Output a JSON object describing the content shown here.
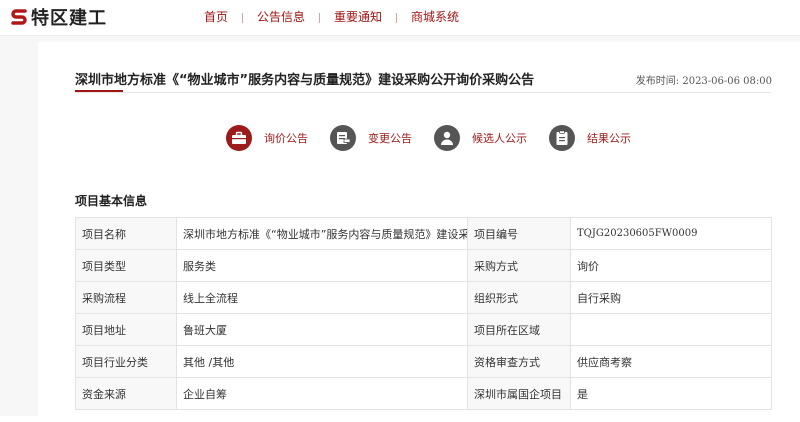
{
  "header": {
    "logo_text": "特区建工",
    "nav": [
      "首页",
      "公告信息",
      "重要通知",
      "商城系统"
    ]
  },
  "article": {
    "title": "深圳市地方标准《“物业城市”服务内容与质量规范》建设采购公开询价采购公告",
    "publish_date": "发布时间: 2023-06-06 08:00"
  },
  "tabs": [
    {
      "label": "询价公告",
      "icon": "briefcase-icon",
      "active": true
    },
    {
      "label": "变更公告",
      "icon": "document-edit-icon",
      "active": false
    },
    {
      "label": "候选人公示",
      "icon": "person-icon",
      "active": false
    },
    {
      "label": "结果公示",
      "icon": "clipboard-icon",
      "active": false
    }
  ],
  "section_title": "项目基本信息",
  "info_rows": [
    {
      "k1": "项目名称",
      "v1": "深圳市地方标准《“物业城市”服务内容与质量规范》建设采购",
      "k2": "项目编号",
      "v2": "TQJG20230605FW0009"
    },
    {
      "k1": "项目类型",
      "v1": "服务类",
      "k2": "采购方式",
      "v2": "询价"
    },
    {
      "k1": "采购流程",
      "v1": "线上全流程",
      "k2": "组织形式",
      "v2": "自行采购"
    },
    {
      "k1": "项目地址",
      "v1": "鲁班大厦",
      "k2": "项目所在区域",
      "v2": ""
    },
    {
      "k1": "项目行业分类",
      "v1": "其他 /其他",
      "k2": "资格审查方式",
      "v2": "供应商考察"
    },
    {
      "k1": "资金来源",
      "v1": "企业自筹",
      "k2": "深圳市属国企项目",
      "v2": "是"
    }
  ],
  "colors": {
    "brand": "#a01414",
    "tab_icon_inactive": "#555555"
  }
}
